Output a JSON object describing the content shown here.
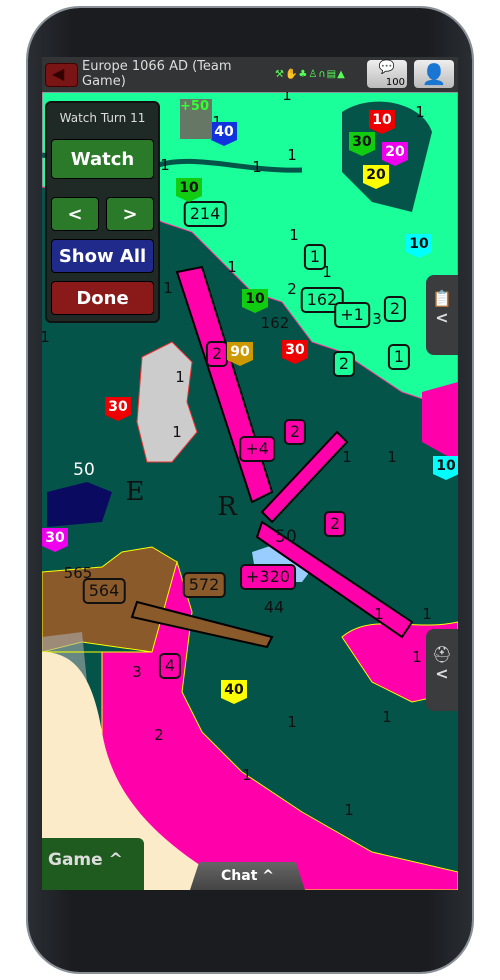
{
  "header": {
    "title": "Europe 1066 AD (Team Game)",
    "resource_icons": "⚒✋♣♙∩▤▲",
    "chat_count": "100",
    "back_icon": "back-arrow-icon",
    "profile_icon": "person-icon"
  },
  "watch_panel": {
    "title": "Watch Turn 11",
    "watch": "Watch",
    "prev": "<",
    "next": ">",
    "show_all": "Show All",
    "done": "Done"
  },
  "side_tabs": [
    {
      "icon": "clipboard-icon",
      "label": "<"
    },
    {
      "icon": "helmet-icon",
      "label": "<"
    }
  ],
  "bottom": {
    "game": "Game ^",
    "chat": "Chat ^"
  },
  "map": {
    "territory_labels": [
      "1",
      "1",
      "1",
      "1",
      "1",
      "1",
      "1",
      "1",
      "1",
      "1",
      "1",
      "1",
      "1",
      "1",
      "1",
      "1",
      "1",
      "1",
      "1",
      "1",
      "1",
      "1",
      "1",
      "1",
      "2",
      "3",
      "162",
      "565",
      "1",
      "E",
      "R",
      "2",
      "3"
    ],
    "badges": [
      "214",
      "162",
      "1",
      "2",
      "+1",
      "2",
      "1",
      "2",
      "+4",
      "2",
      "2",
      "572",
      "564",
      "+320",
      "4"
    ],
    "shields": [
      "40",
      "10",
      "30",
      "10",
      "20",
      "20",
      "10",
      "10",
      "90",
      "30",
      "30",
      "30",
      "40",
      "10",
      "+50"
    ],
    "ships": [
      "50",
      "50",
      "44"
    ],
    "colors": {
      "sea": "#04544a",
      "green_team": "#1aff9a",
      "pink_team": "#ff00aa",
      "brown_team": "#8b5a2b",
      "neutral": "#cccccc",
      "desert": "#fbebc8"
    }
  }
}
